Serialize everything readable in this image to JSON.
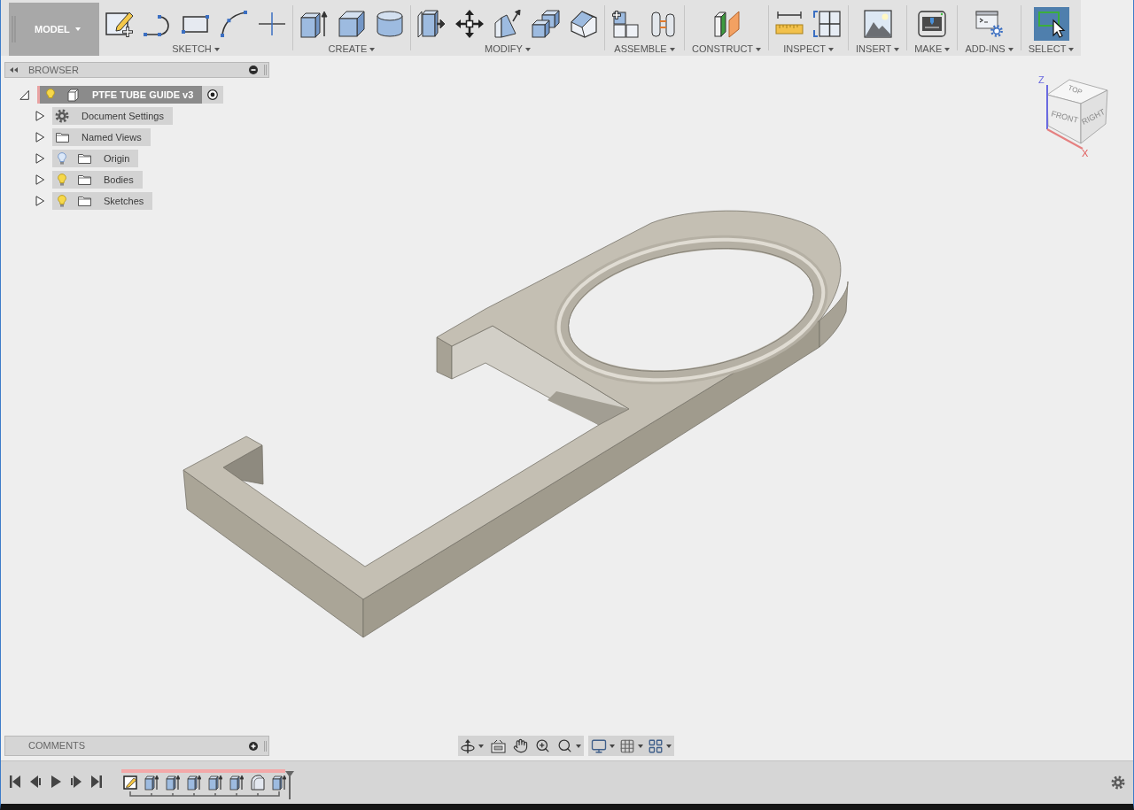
{
  "toolbar": {
    "workspace": {
      "label": "MODEL"
    },
    "groups": [
      {
        "label": "SKETCH",
        "tools": [
          {
            "kind": "create-sketch",
            "selected": false
          },
          {
            "kind": "line-arc",
            "selected": false
          },
          {
            "kind": "rectangle",
            "selected": false
          },
          {
            "kind": "arc",
            "selected": false
          },
          {
            "kind": "project",
            "selected": false
          }
        ]
      },
      {
        "label": "CREATE",
        "tools": [
          {
            "kind": "extrude",
            "selected": false
          },
          {
            "kind": "box",
            "selected": false
          },
          {
            "kind": "cylinder",
            "selected": false
          }
        ]
      },
      {
        "label": "MODIFY",
        "tools": [
          {
            "kind": "press-pull",
            "selected": false
          },
          {
            "kind": "move",
            "selected": false
          },
          {
            "kind": "draft",
            "selected": false
          },
          {
            "kind": "combine",
            "selected": false
          },
          {
            "kind": "chamfer",
            "selected": false
          }
        ]
      },
      {
        "label": "ASSEMBLE",
        "tools": [
          {
            "kind": "new-component",
            "selected": false
          },
          {
            "kind": "joint",
            "selected": false
          }
        ]
      },
      {
        "label": "CONSTRUCT",
        "tools": [
          {
            "kind": "plane",
            "selected": false
          }
        ]
      },
      {
        "label": "INSPECT",
        "tools": [
          {
            "kind": "measure",
            "selected": false
          },
          {
            "kind": "section",
            "selected": false
          }
        ]
      },
      {
        "label": "INSERT",
        "tools": [
          {
            "kind": "image",
            "selected": false
          }
        ]
      },
      {
        "label": "MAKE",
        "tools": [
          {
            "kind": "print",
            "selected": false
          }
        ]
      },
      {
        "label": "ADD-INS",
        "tools": [
          {
            "kind": "scripts",
            "selected": false
          }
        ]
      },
      {
        "label": "SELECT",
        "tools": [
          {
            "kind": "select",
            "selected": true
          }
        ]
      }
    ]
  },
  "browser": {
    "title": "BROWSER",
    "root": {
      "label": "PTFE TUBE GUIDE v3",
      "active": true,
      "expanded": true,
      "light_on": true,
      "children": [
        {
          "label": "Document Settings",
          "kind": "settings",
          "active": false,
          "expanded": false
        },
        {
          "label": "Named Views",
          "kind": "folder",
          "active": false,
          "expanded": false
        },
        {
          "label": "Origin",
          "kind": "light-folder",
          "active": false,
          "light_on": false,
          "expanded": false
        },
        {
          "label": "Bodies",
          "kind": "light-folder",
          "active": false,
          "light_on": true,
          "expanded": false
        },
        {
          "label": "Sketches",
          "kind": "light-folder",
          "active": false,
          "light_on": true,
          "expanded": false
        }
      ]
    }
  },
  "view_cube": {
    "faces": {
      "top": "TOP",
      "front": "FRONT",
      "right": "RIGHT"
    },
    "axes": {
      "vertical": "Z",
      "horizontal": "X"
    }
  },
  "comments": {
    "title": "COMMENTS"
  },
  "timeline": {
    "features": [
      {
        "kind": "sketch"
      },
      {
        "kind": "extrude"
      },
      {
        "kind": "extrude"
      },
      {
        "kind": "extrude"
      },
      {
        "kind": "extrude"
      },
      {
        "kind": "extrude"
      },
      {
        "kind": "fillet"
      },
      {
        "kind": "extrude"
      }
    ]
  }
}
